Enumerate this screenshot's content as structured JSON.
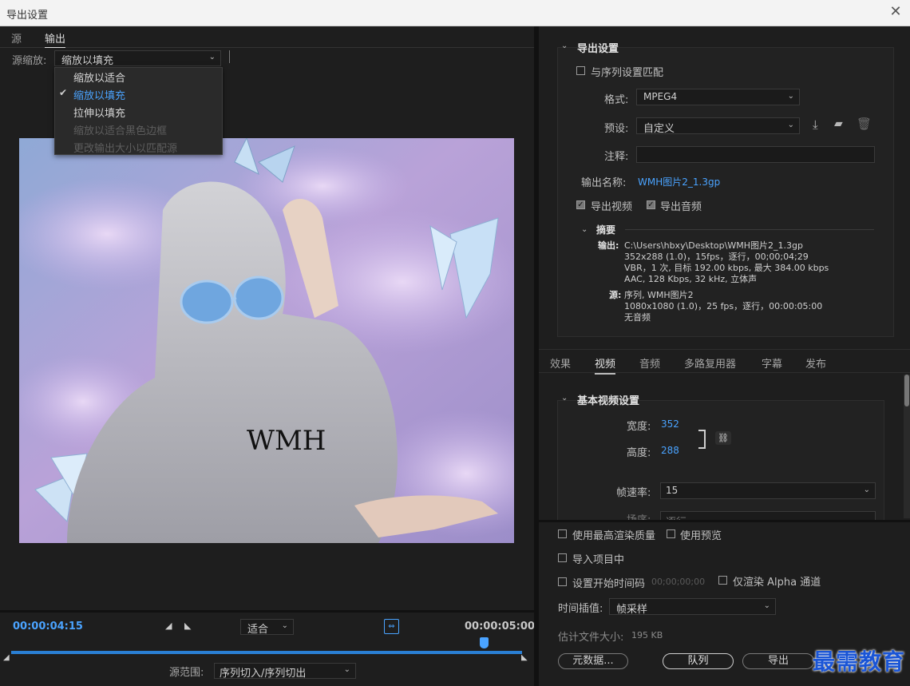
{
  "window": {
    "title": "导出设置",
    "close_icon": "close-icon"
  },
  "left": {
    "tabs": [
      "源",
      "输出"
    ],
    "source_scale": {
      "label": "源缩放:",
      "value": "缩放以填充",
      "options": [
        {
          "label": "缩放以适合",
          "state": "normal"
        },
        {
          "label": "缩放以填充",
          "state": "selected"
        },
        {
          "label": "拉伸以填充",
          "state": "normal"
        },
        {
          "label": "缩放以适合黑色边框",
          "state": "disabled"
        },
        {
          "label": "更改输出大小以匹配源",
          "state": "disabled"
        }
      ]
    },
    "timeline": {
      "current_time": "00:00:04:15",
      "end_time": "00:00:05:00",
      "fit_value": "适合",
      "playhead_fraction": 0.925,
      "range_label": "源范围:",
      "range_value": "序列切入/序列切出"
    }
  },
  "right": {
    "export_settings": {
      "header": "导出设置",
      "match_sequence": "与序列设置匹配",
      "format_label": "格式:",
      "format_value": "MPEG4",
      "preset_label": "预设:",
      "preset_value": "自定义",
      "comment_label": "注释:",
      "comment_value": "",
      "output_name_label": "输出名称:",
      "output_name_value": "WMH图片2_1.3gp",
      "export_video": "导出视频",
      "export_audio": "导出音频",
      "summary": {
        "header": "摘要",
        "output_label": "输出:",
        "output_lines": [
          "C:\\Users\\hbxy\\Desktop\\WMH图片2_1.3gp",
          "352x288 (1.0)，15fps，逐行，00;00;04;29",
          "VBR，1 次, 目标 192.00 kbps, 最大 384.00 kbps",
          "AAC, 128 Kbps, 32  kHz, 立体声"
        ],
        "source_label": "源:",
        "source_lines": [
          "序列, WMH图片2",
          "1080x1080 (1.0)，25 fps，逐行，00:00:05:00",
          "无音频"
        ]
      }
    },
    "tabs": [
      "效果",
      "视频",
      "音频",
      "多路复用器",
      "字幕",
      "发布"
    ],
    "video": {
      "header": "基本视频设置",
      "width_label": "宽度:",
      "width_value": "352",
      "height_label": "高度:",
      "height_value": "288",
      "fps_label": "帧速率:",
      "fps_value": "15",
      "field_label": "场序:",
      "field_value": "逐行"
    },
    "bottom": {
      "max_render": "使用最高渲染质量",
      "use_previews": "使用预览",
      "import_project": "导入项目中",
      "set_start_tc": "设置开始时间码",
      "start_tc_value": "00;00;00;00",
      "alpha_only": "仅渲染 Alpha 通道",
      "interp_label": "时间插值:",
      "interp_value": "帧采样",
      "est_size_label": "估计文件大小:",
      "est_size_value": "195 KB",
      "metadata_btn": "元数据...",
      "queue_btn": "队列",
      "export_btn": "导出"
    }
  },
  "watermark": "最需教育",
  "colors": {
    "accent_blue": "#4aa3ff",
    "timeline_blue": "#2a7fd4",
    "watermark": "#1a55d6"
  }
}
